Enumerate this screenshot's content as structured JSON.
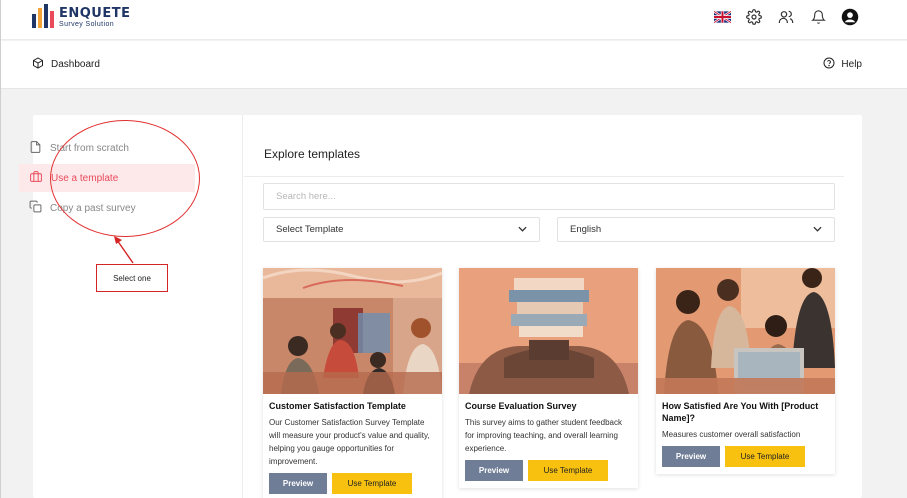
{
  "brand": {
    "title": "ENQUETE",
    "subtitle": "Survey Solution"
  },
  "topbar": {
    "icons": [
      "uk-flag-icon",
      "gear-icon",
      "users-icon",
      "bell-icon",
      "account-icon"
    ]
  },
  "breadcrumb": {
    "label": "Dashboard"
  },
  "help": {
    "label": "Help"
  },
  "left_options": [
    {
      "label": "Start from scratch",
      "icon": "file-icon",
      "active": false
    },
    {
      "label": "Use a template",
      "icon": "briefcase-icon",
      "active": true
    },
    {
      "label": "Copy a past survey",
      "icon": "copy-icon",
      "active": false
    }
  ],
  "annotation": {
    "label": "Select one",
    "color": "#d42424"
  },
  "explore": {
    "title": "Explore templates",
    "search_placeholder": "Search here...",
    "template_select": "Select Template",
    "language_select": "English"
  },
  "templates": [
    {
      "name": "Customer Satisfaction Template",
      "description": "Our Customer Satisfaction Survey Template will measure your product's value and quality, helping you gauge opportunities for improvement.",
      "preview": "Preview",
      "use": "Use Template"
    },
    {
      "name": "Course Evaluation Survey",
      "description": "This survey aims to gather student feedback for improving teaching, and overall learning experience.",
      "preview": "Preview",
      "use": "Use Template"
    },
    {
      "name": "How Satisfied Are You With [Product Name]?",
      "description": "Measures customer overall satisfaction",
      "preview": "Preview",
      "use": "Use Template"
    }
  ],
  "colors": {
    "accent_pink": "#e94b5b",
    "active_bg": "#fde8ea",
    "preview_button": "#6f7d96",
    "use_button": "#f9c10f",
    "brand_navy": "#1f3566"
  }
}
